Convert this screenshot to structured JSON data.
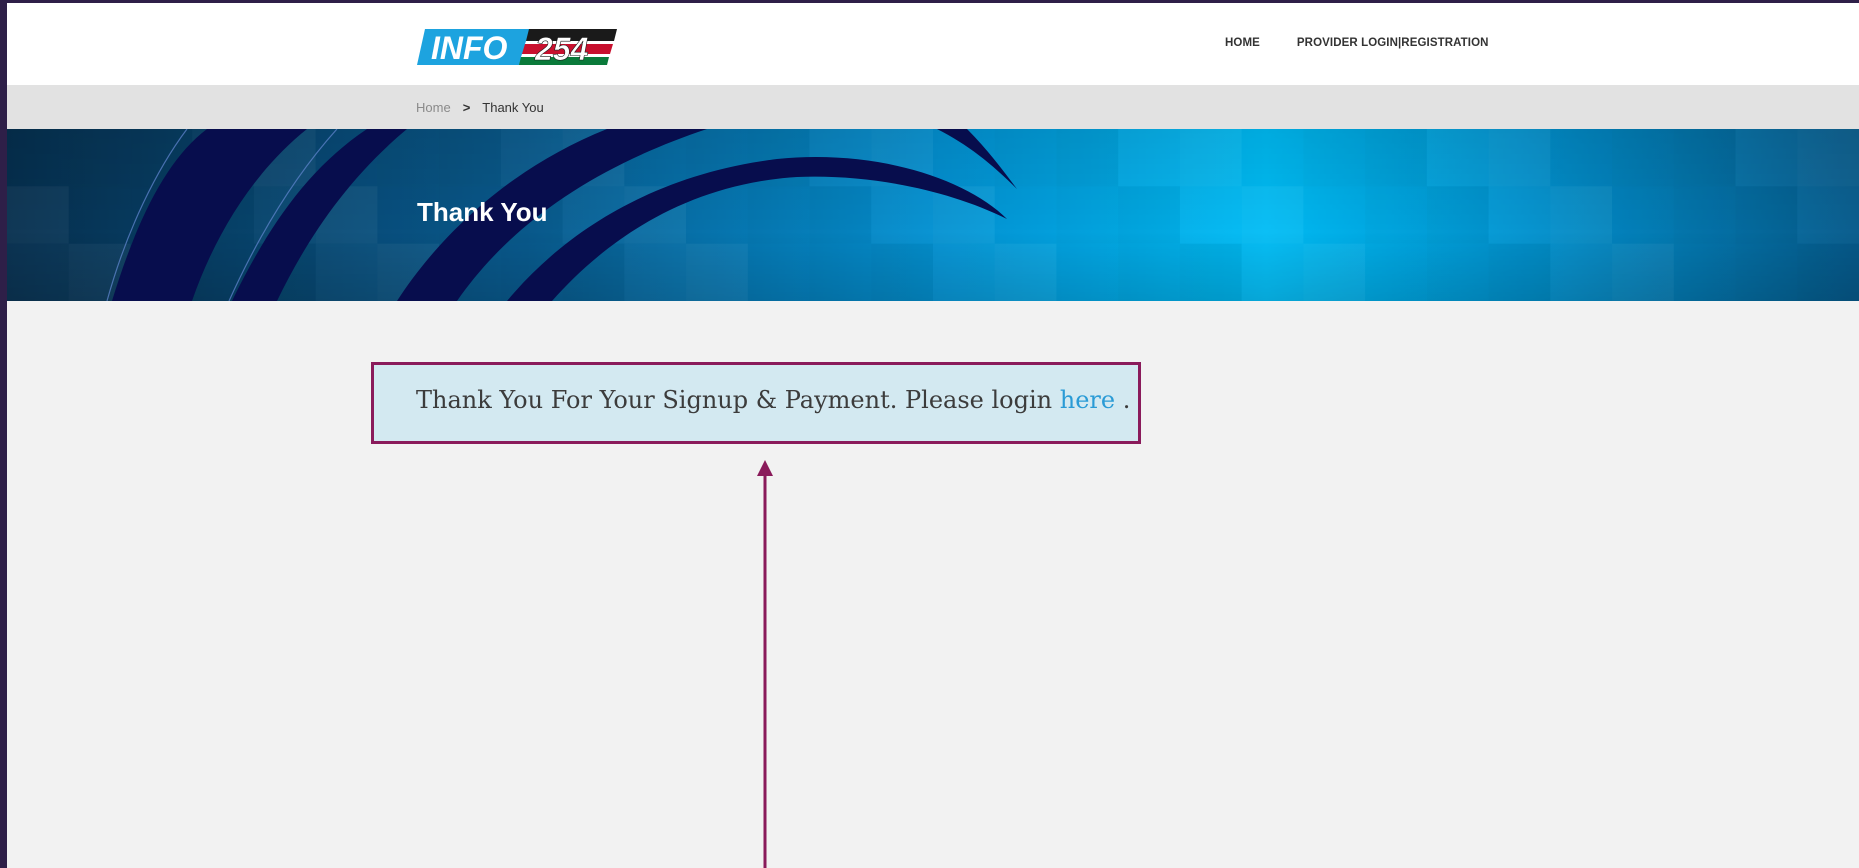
{
  "logo": {
    "info_text": "INFO",
    "num_text": "254"
  },
  "nav": {
    "home": "HOME",
    "provider": "PROVIDER LOGIN|REGISTRATION"
  },
  "breadcrumb": {
    "home": "Home",
    "separator": ">",
    "current": "Thank You"
  },
  "banner": {
    "title": "Thank You"
  },
  "message": {
    "text_before": "Thank You For Your Signup & Payment. Please login ",
    "link": "here",
    "text_after": " ."
  },
  "colors": {
    "highlight_border": "#8a1b5b",
    "message_bg": "#d3e9f1",
    "link": "#2a9bd6",
    "banner_dark": "#0a1a4a",
    "banner_bright": "#02b8f2"
  }
}
